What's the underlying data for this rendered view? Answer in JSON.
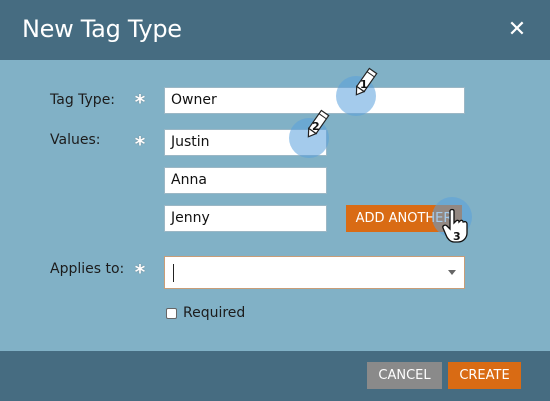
{
  "dialog": {
    "title": "New Tag Type",
    "close_icon": "close-icon"
  },
  "form": {
    "tag_type": {
      "label": "Tag Type:",
      "value": "Owner"
    },
    "values": {
      "label": "Values:",
      "items": [
        "Justin",
        "Anna",
        "Jenny"
      ],
      "add_button": "ADD ANOTHER"
    },
    "applies_to": {
      "label": "Applies to:",
      "value": ""
    },
    "required": {
      "label": "Required",
      "checked": false
    }
  },
  "footer": {
    "cancel": "CANCEL",
    "create": "CREATE"
  },
  "annotations": {
    "step1": "1",
    "step2": "2",
    "step3": "3",
    "pencil_icon": "pencil-icon",
    "hand_cursor_icon": "hand-cursor-icon"
  },
  "colors": {
    "header_footer": "#466c81",
    "body_bg": "#81b1c6",
    "accent_orange": "#d96b14",
    "cancel_gray": "#8a8a8a"
  }
}
